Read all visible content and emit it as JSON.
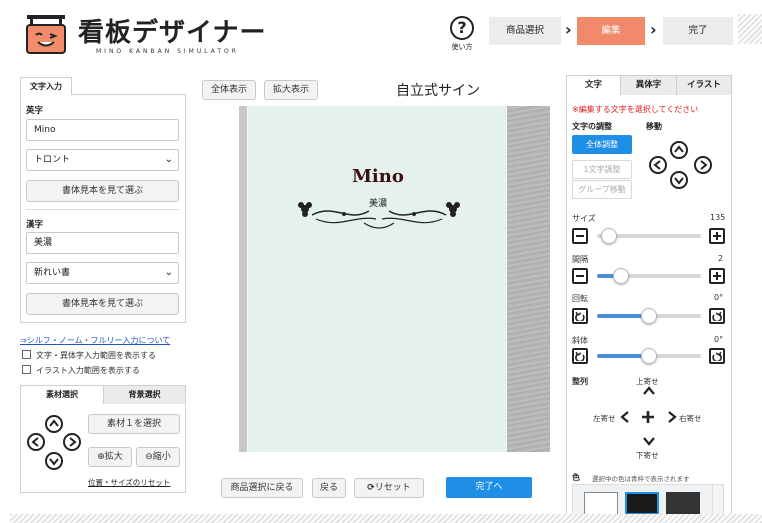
{
  "header": {
    "title": "看板デザイナー",
    "subtitle": "MINO KANBAN SIMULATOR",
    "help_label": "使い方",
    "steps": [
      {
        "label": "商品選択"
      },
      {
        "label": "編集"
      },
      {
        "label": "完了"
      }
    ],
    "active_step_color": "#f08a6a"
  },
  "left": {
    "tab": "文字入力",
    "english_label": "英字",
    "english_value": "Mino",
    "english_font": "トロント",
    "choose_font_button": "書体見本を見て選ぶ",
    "kanji_label": "漢字",
    "kanji_value": "美濃",
    "kanji_font": "新れい書",
    "choose_font_button2": "書体見本を見て選ぶ",
    "link": "⇒シルフ・ノーム・フルリー入力について",
    "check1": "文字・異体字入力範囲を表示する",
    "check2": "イラスト入力範囲を表示する",
    "tabs2": [
      "素材選択",
      "背景選択"
    ],
    "material_button": "素材１を選択",
    "zoom_in": "拡大",
    "zoom_out": "縮小",
    "reset_link": "位置・サイズのリセット"
  },
  "center": {
    "full_view": "全体表示",
    "zoom_view": "拡大表示",
    "title": "自立式サイン",
    "sign_main": "Mino",
    "sign_sub": "美濃",
    "back_to_select": "商品選択に戻る",
    "back": "戻る",
    "reset": "リセット",
    "done": "完了へ"
  },
  "right": {
    "tabs": [
      "文字",
      "異体字",
      "イラスト"
    ],
    "notice": "※編集する文字を選択してください",
    "adjust_label": "文字の調整",
    "move_label": "移動",
    "all_adjust": "全体調整",
    "char_adjust": "1文字調整",
    "group_move": "グループ移動",
    "size_label": "サイズ",
    "size_value": "135",
    "size_level": 0.05,
    "spacing_label": "間隔",
    "spacing_value": "2",
    "spacing_level": 0.18,
    "rotate_label": "回転",
    "rotate_value": "0°",
    "rotate_level": 0.5,
    "skew_label": "斜体",
    "skew_value": "0°",
    "skew_level": 0.5,
    "align_label": "整列",
    "align_top": "上寄せ",
    "align_left": "左寄せ",
    "align_right": "右寄せ",
    "align_bottom": "下寄せ",
    "color_label": "色",
    "color_note": "選択中の色は青枠で表示されます",
    "swatches": [
      "#ffffff",
      "#1a1a1a",
      "#333333"
    ]
  }
}
